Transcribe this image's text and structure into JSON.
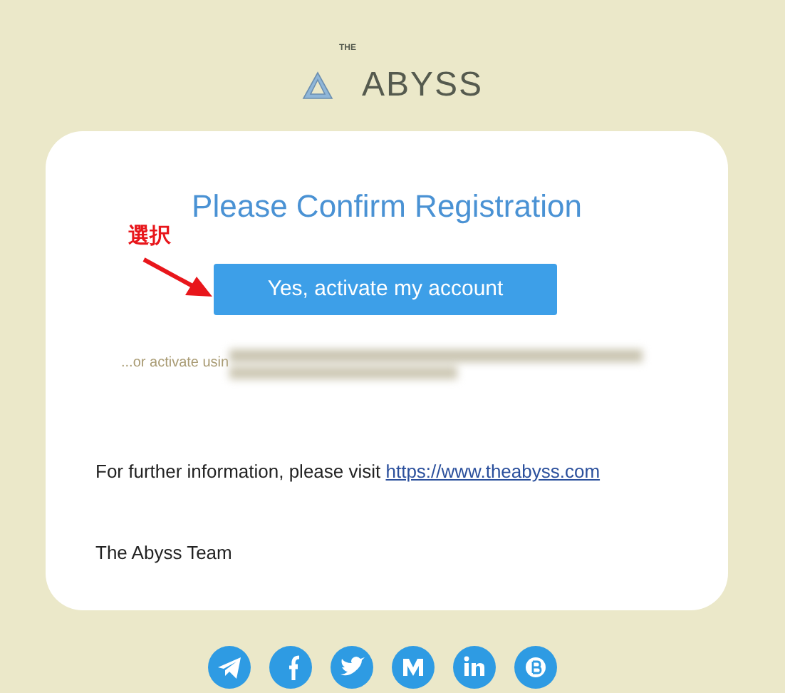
{
  "logo": {
    "prefix": "THE",
    "name": "ABYSS"
  },
  "card": {
    "title": "Please Confirm Registration",
    "button": "Yes, activate my account",
    "fallback_text": "...or activate usin",
    "info_text": "For further information, please visit",
    "info_link": "https://www.theabyss.com",
    "signature": "The Abyss Team"
  },
  "annotation": {
    "label": "選択"
  },
  "social": [
    {
      "kind": "telegram"
    },
    {
      "kind": "facebook"
    },
    {
      "kind": "twitter"
    },
    {
      "kind": "medium"
    },
    {
      "kind": "linkedin"
    },
    {
      "kind": "bitcoin"
    }
  ]
}
